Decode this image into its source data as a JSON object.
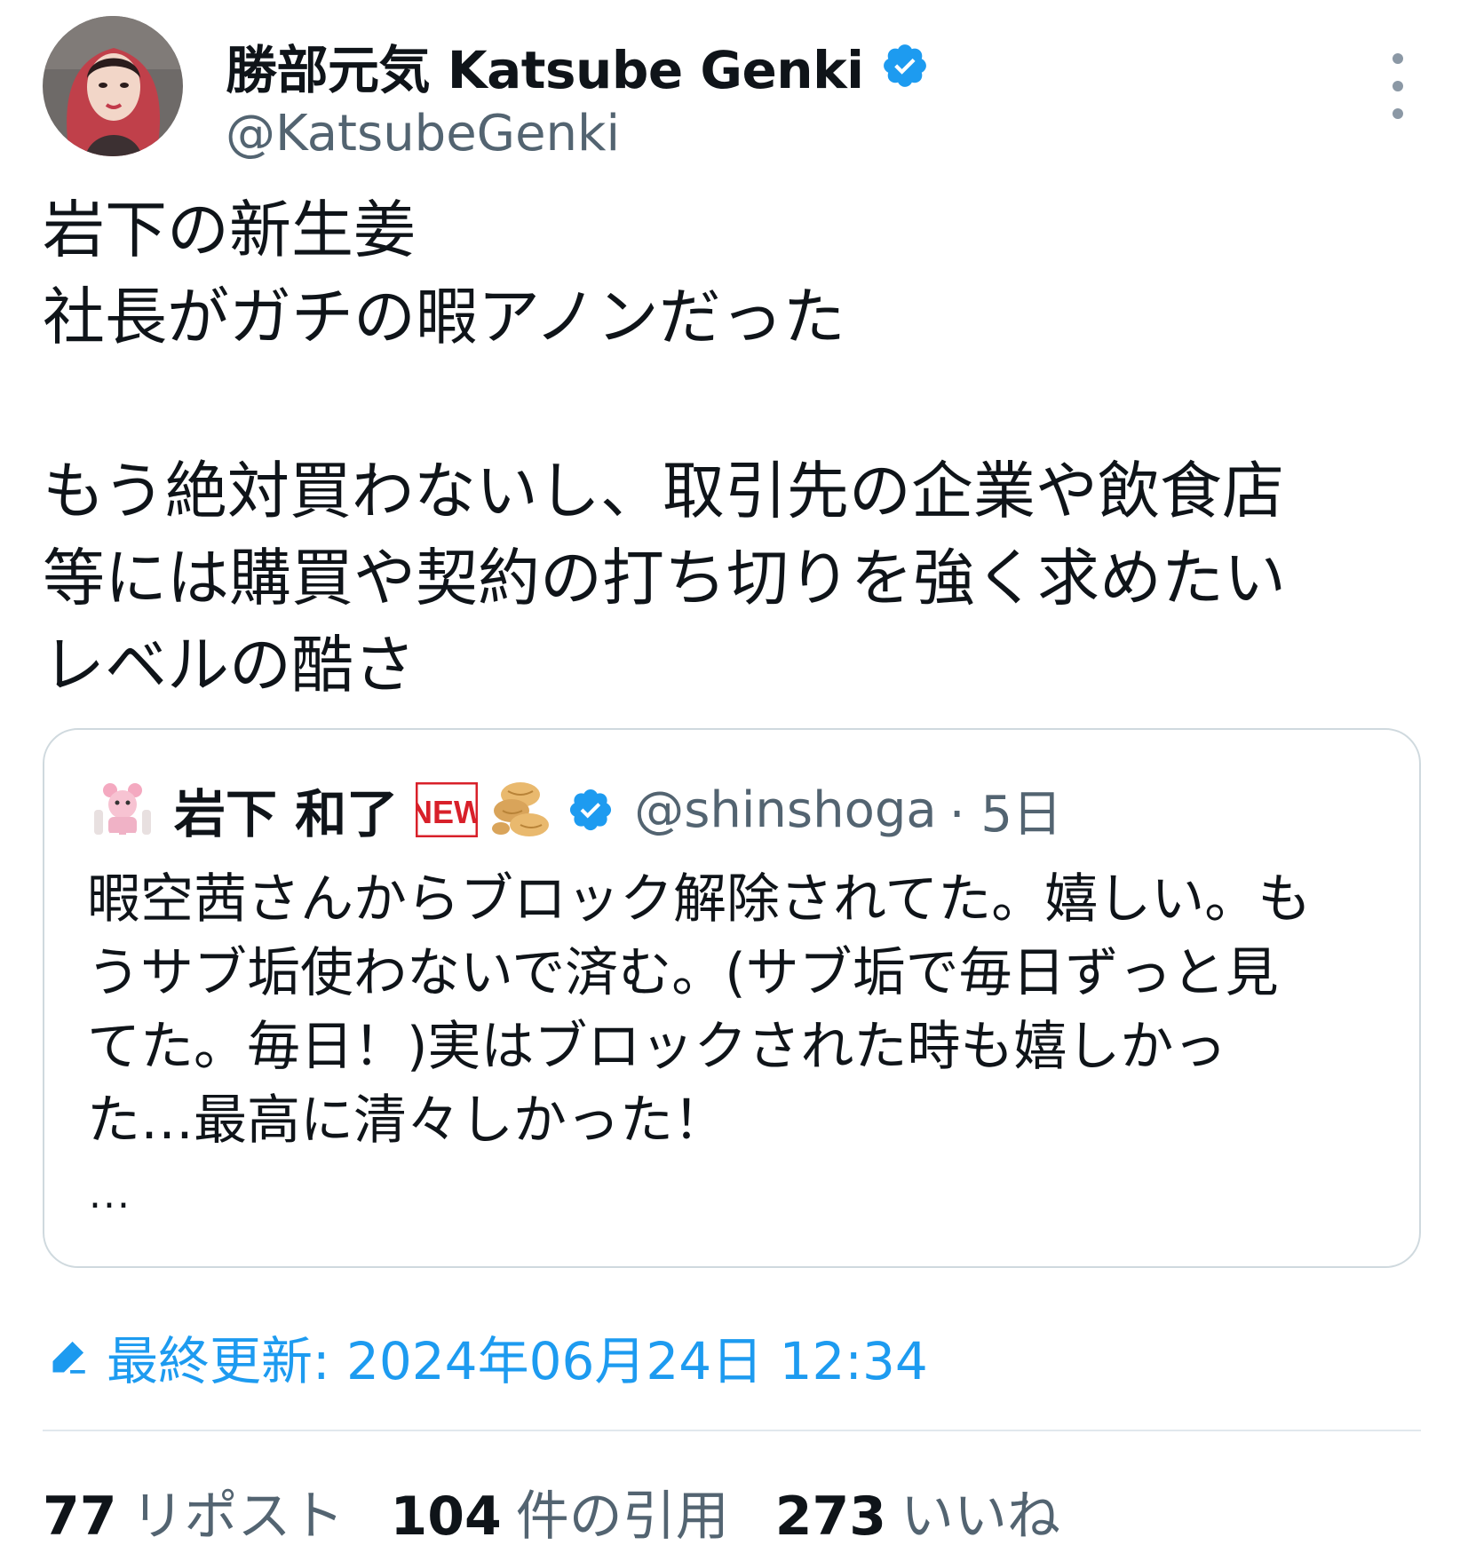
{
  "author": {
    "name": "勝部元気 Katsube Genki",
    "handle": "@KatsubeGenki"
  },
  "tweet": {
    "lines": [
      "岩下の新生姜",
      "社長がガチの暇アノンだった",
      "",
      "もう絶対買わないし、取引先の企業や飲食店",
      "等には購買や契約の打ち切りを強く求めたい",
      "レベルの酷さ"
    ]
  },
  "quote": {
    "name": "岩下 和了",
    "badge": "NEW",
    "handle": "@shinshoga",
    "time": "· 5日",
    "lines": [
      "暇空茜さんからブロック解除されてた。嬉しい。も",
      "うサブ垢使わないで済む。(サブ垢で毎日ずっと見",
      "てた。毎日！)実はブロックされた時も嬉しかっ",
      "た…最高に清々しかった！"
    ],
    "ellipsis": "..."
  },
  "edited": {
    "label": "最終更新: 2024年06月24日 12:34"
  },
  "stats": {
    "reposts": {
      "count": "77",
      "label": "リポスト"
    },
    "quotes": {
      "count": "104",
      "label": "件の引用"
    },
    "likes": {
      "count": "273",
      "label": "いいね"
    }
  },
  "colors": {
    "accent": "#1d9bf0",
    "verified": "#1d9bf0",
    "secondary_text": "#536471",
    "border": "#cfd9de"
  },
  "icons": [
    "verified-badge-icon",
    "more-options-icon",
    "new-badge-icon",
    "ginger-icon",
    "pencil-icon"
  ]
}
